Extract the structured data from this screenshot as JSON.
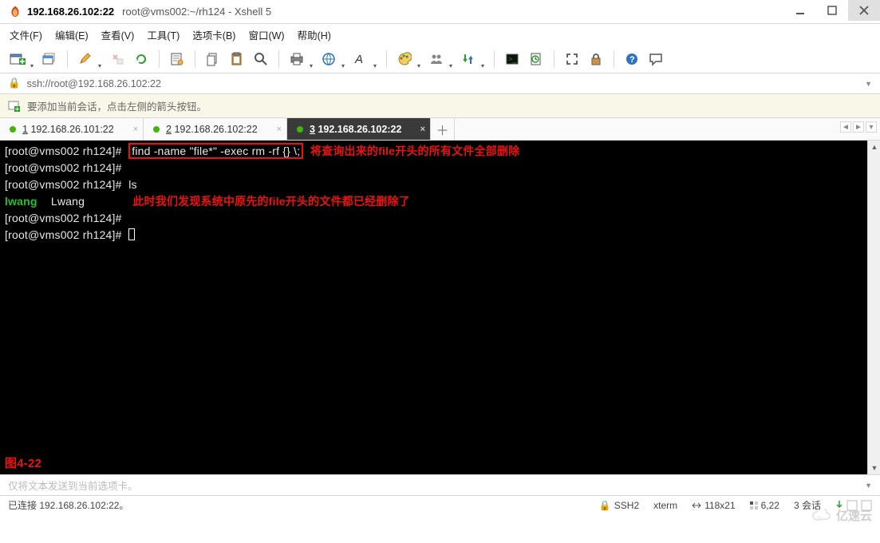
{
  "title": {
    "host": "192.168.26.102:22",
    "suffix": "root@vms002:~/rh124 - Xshell 5"
  },
  "menu": {
    "file": "文件(F)",
    "edit": "编辑(E)",
    "view": "查看(V)",
    "tools": "工具(T)",
    "tabs": "选项卡(B)",
    "window": "窗口(W)",
    "help": "帮助(H)"
  },
  "address": {
    "url": "ssh://root@192.168.26.102:22"
  },
  "tip": {
    "text": "要添加当前会话，点击左侧的箭头按钮。"
  },
  "tabs": [
    {
      "n": "1",
      "label": "192.168.26.101:22",
      "active": false
    },
    {
      "n": "2",
      "label": "192.168.26.102:22",
      "active": false
    },
    {
      "n": "3",
      "label": "192.168.26.102:22",
      "active": true
    }
  ],
  "terminal": {
    "prompt": "[root@vms002 rh124]#",
    "find_cmd": "find -name \"file*\" -exec rm -rf {} \\;",
    "anno1": "将查询出来的file开头的所有文件全部删除",
    "ls_cmd": "ls",
    "ls_out_a": "lwang",
    "ls_out_b": "Lwang",
    "anno2": "此时我们发现系统中原先的file开头的文件都已经删除了",
    "figure": "图4-22"
  },
  "sendbar": {
    "placeholder": "仅将文本发送到当前选项卡。"
  },
  "status": {
    "conn": "已连接 192.168.26.102:22。",
    "proto": "SSH2",
    "term": "xterm",
    "size": "118x21",
    "pos": "6,22",
    "sess": "3 会话"
  },
  "watermark": "亿速云",
  "icons": {
    "new_tab": "new-tab-icon",
    "new": "new-icon",
    "pencil": "pencil-icon",
    "scissors": "scissors-icon",
    "refresh": "refresh-icon",
    "props": "properties-icon",
    "copy": "copy-icon",
    "paste": "paste-icon",
    "find": "find-icon",
    "print": "print-icon",
    "globe": "globe-icon",
    "font": "font-icon",
    "color": "color-theme-icon",
    "users": "sessions-icon",
    "yy": "transfer-icon",
    "cmd": "command-icon",
    "script": "script-icon",
    "expand": "fullscreen-icon",
    "lock": "lock-icon",
    "help": "help-icon",
    "chat": "chat-icon"
  }
}
